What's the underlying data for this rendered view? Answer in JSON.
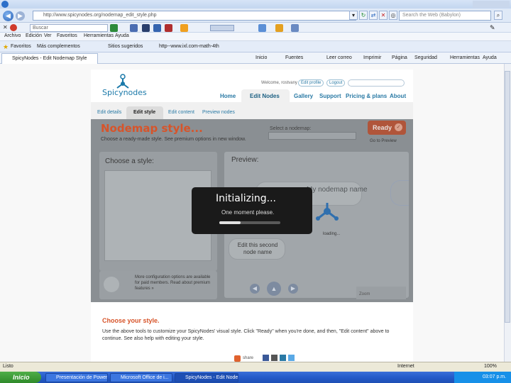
{
  "browser": {
    "address": "http://www.spicynodes.org/nodemap_edit_style.php",
    "search_placeholder": "Search the Web (Babylon)",
    "toolbar_search_value": "Buscar",
    "menu": [
      "Archivo",
      "Edición",
      "Ver",
      "Favoritos",
      "Herramientas",
      "Ayuda"
    ],
    "favorites_label": "Favoritos",
    "favorites_links": [
      "Más complementos",
      "Sitios sugeridos",
      "http--www.ixl.com-math-4th"
    ],
    "tab_title": "SpicyNodes - Edit Nodemap Style",
    "command_items": [
      "Inicio",
      "Fuentes",
      "Leer correo",
      "Imprimir",
      "Página",
      "Seguridad",
      "Herramientas",
      "Ayuda"
    ]
  },
  "site": {
    "logo_text": "Spicynodes",
    "welcome_text": "Welcome, rostvany",
    "edit_profile": "Edit profile",
    "logout": "Logout",
    "nav": [
      "Home",
      "Edit Nodes",
      "Gallery",
      "Support",
      "Pricing & plans",
      "About"
    ],
    "subtabs": [
      "Edit details",
      "Edit style",
      "Edit content",
      "Preview nodes"
    ],
    "heading": "Nodemap style...",
    "subheading": "Choose a ready-made style. See premium options in new window.",
    "select_label": "Select a nodemap:",
    "ready_button": "Ready",
    "goto_preview": "Go to Preview",
    "choose_style": "Choose a style:",
    "preview": "Preview:",
    "node_text_1": "My nodemap name",
    "node_text_2": "Edit this second node name",
    "loading": "loading...",
    "premium_note": "More configuration options are available for paid members. Read about premium features »",
    "zoom": "Zoom",
    "choose_heading": "Choose your style.",
    "help_text": "Use the above tools to customize your SpicyNodes' visual style. Click \"Ready\" when you're done, and then, \"Edit content\" above to continue. See also help with editing your style.",
    "share": "share"
  },
  "dialog": {
    "title": "Initializing...",
    "message": "One moment please.",
    "progress": 0.35
  },
  "status": {
    "left": "Listo",
    "zone": "Internet",
    "zoom": "100%"
  },
  "taskbar": {
    "start": "Inicio",
    "tasks": [
      "Presentación de Power...",
      "Microsoft Office de i...",
      "SpicyNodes - Edit Nodem..."
    ],
    "clock": "03:07 p.m."
  },
  "colors": {
    "accent_orange": "#d7542a",
    "link_blue": "#2a7aa5",
    "dialog_bg": "#1a1a1a"
  }
}
